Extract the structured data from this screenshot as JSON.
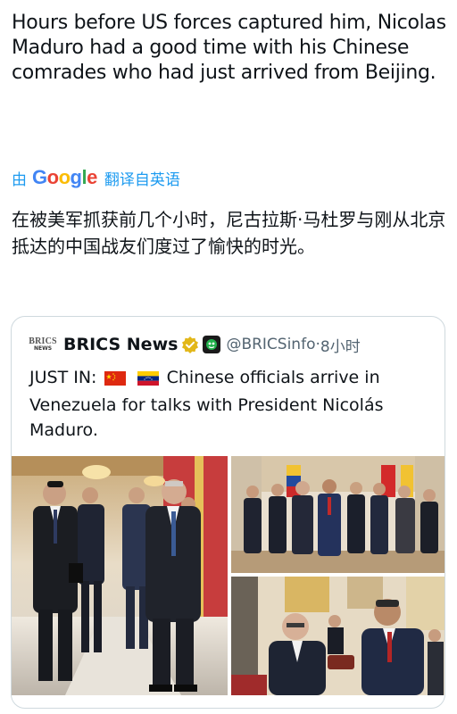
{
  "tweet": {
    "text": "Hours before US forces captured him, Nicolas Maduro had a good time with his Chinese comrades who had just arrived from Beijing.",
    "translation": {
      "by_label": "由",
      "provider_logo": [
        "G",
        "o",
        "o",
        "g",
        "l",
        "e"
      ],
      "action_label": "翻译自英语",
      "text": "在被美军抓获前几个小时，尼古拉斯·马杜罗与刚从北京抵达的中国战友们度过了愉快的时光。"
    }
  },
  "quote": {
    "logo_text": "BRICS",
    "logo_subtext": "NEWS",
    "name": "BRICS News",
    "verified_badge": "gold-verified-icon",
    "automated_badge": "bot-icon",
    "handle": "@BRICSinfo",
    "separator": "·",
    "time": "8小时",
    "text_prefix": "JUST IN:",
    "text_body": "Chinese officials arrive in Venezuela for talks with President Nicolás Maduro.",
    "flags": [
      "china-flag-icon",
      "venezuela-flag-icon"
    ],
    "media": [
      "delegation-walking-photo",
      "group-photo-with-flags",
      "handshake-gift-photo"
    ]
  },
  "colors": {
    "link_blue": "#1d9bf0",
    "text": "#0f1419",
    "muted": "#536471",
    "border": "#cfd9de",
    "verified_gold": "#e2b719"
  }
}
